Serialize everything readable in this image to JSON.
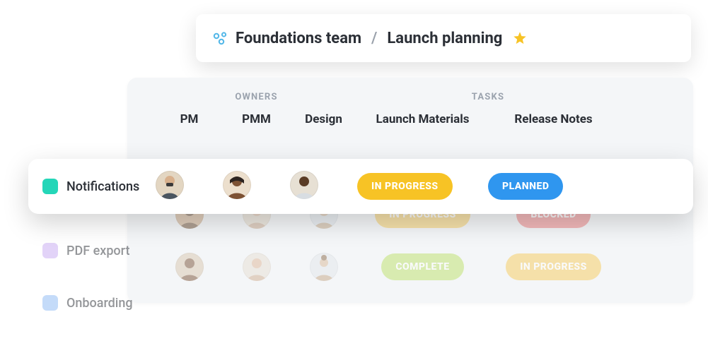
{
  "breadcrumb": {
    "team": "Foundations team",
    "page": "Launch planning"
  },
  "groups": {
    "owners": "OWNERS",
    "tasks": "TASKS"
  },
  "columns": {
    "pm": "PM",
    "pmm": "PMM",
    "design": "Design",
    "launch_materials": "Launch Materials",
    "release_notes": "Release Notes"
  },
  "rows": [
    {
      "feature": "Notifications",
      "color": "#24d6b8",
      "launch_status": "IN PROGRESS",
      "launch_color": "yellow",
      "release_status": "PLANNED",
      "release_color": "blue"
    },
    {
      "feature": "PDF export",
      "color": "#c6a9f2",
      "launch_status": "IN PROGRESS",
      "launch_color": "yellow-m",
      "release_status": "BLOCKED",
      "release_color": "red"
    },
    {
      "feature": "Onboarding",
      "color": "#8bb8f5",
      "launch_status": "COMPLETE",
      "launch_color": "green",
      "release_status": "IN PROGRESS",
      "release_color": "yellow-m"
    }
  ]
}
